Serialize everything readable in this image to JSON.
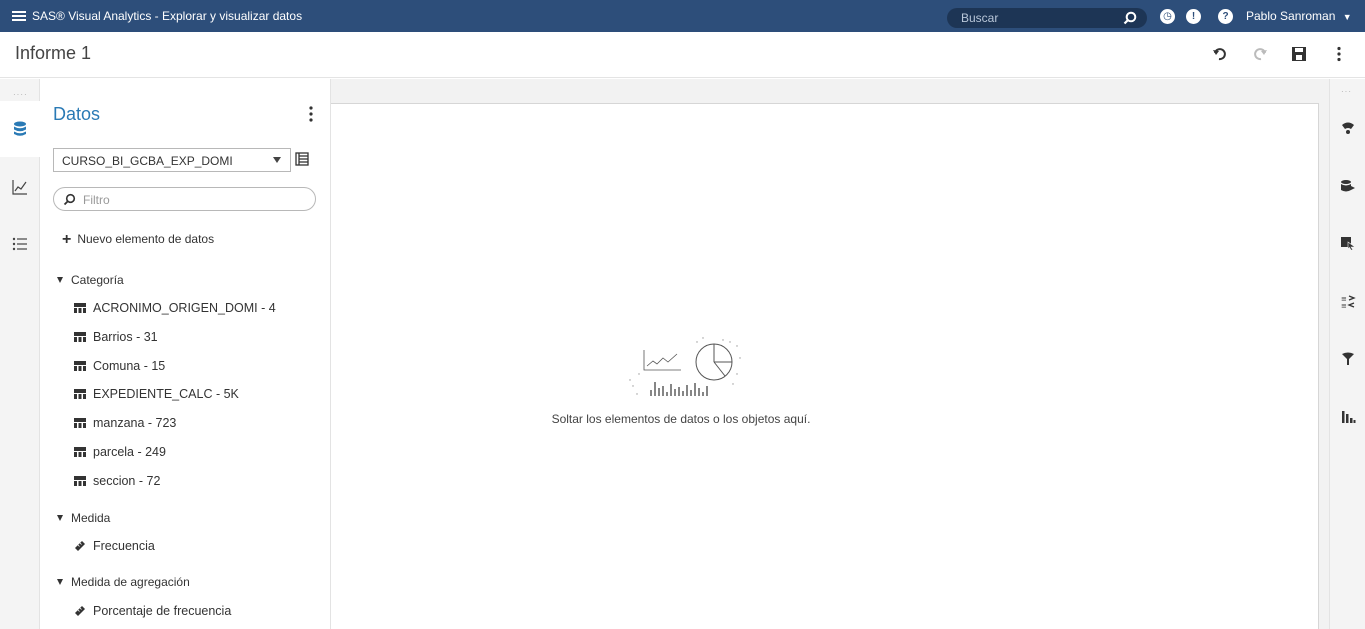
{
  "app": {
    "title": "SAS® Visual Analytics - Explorar y visualizar datos",
    "search_placeholder": "Buscar",
    "user_name": "Pablo Sanroman"
  },
  "report": {
    "title": "Informe 1"
  },
  "left_rail": {
    "items": [
      "data-icon",
      "objects-icon",
      "outline-icon"
    ]
  },
  "data_pane": {
    "title": "Datos",
    "datasource": "CURSO_BI_GCBA_EXP_DOMI",
    "filter_placeholder": "Filtro",
    "new_item_label": "Nuevo elemento de datos",
    "groups": [
      {
        "label": "Categoría",
        "items": [
          "ACRONIMO_ORIGEN_DOMI - 4",
          "Barrios - 31",
          "Comuna - 15",
          "EXPEDIENTE_CALC - 5K",
          "manzana - 723",
          "parcela - 249",
          "seccion - 72"
        ]
      },
      {
        "label": "Medida",
        "items": [
          "Frecuencia"
        ]
      },
      {
        "label": "Medida de agregación",
        "items": [
          "Porcentaje de frecuencia"
        ]
      }
    ]
  },
  "canvas": {
    "drop_message": "Soltar los elementos de datos o los objetos aquí."
  },
  "right_rail": {
    "items": [
      "options-icon",
      "roles-icon",
      "actions-icon",
      "rules-icon",
      "filters-icon",
      "ranks-icon"
    ]
  }
}
